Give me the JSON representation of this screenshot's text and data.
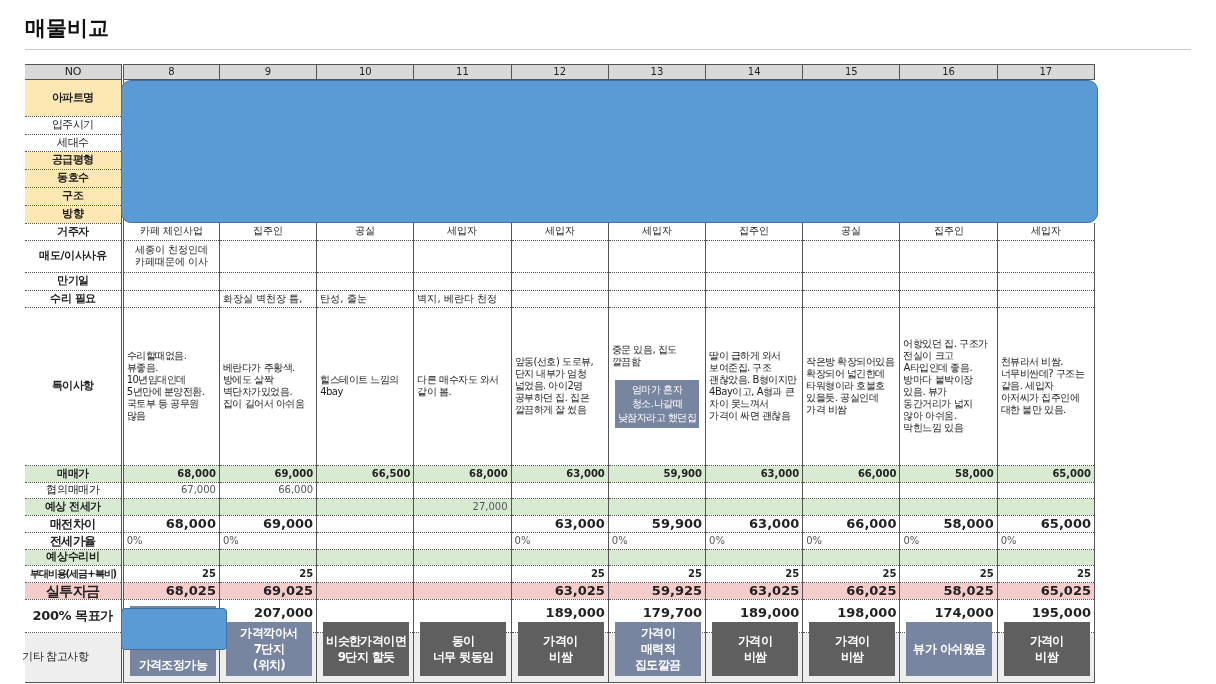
{
  "title": "매물비교",
  "rows": [
    {
      "label": "NO",
      "kind": "header",
      "color": "#d9d9d9",
      "bold": false
    },
    {
      "label": "아파트명",
      "kind": "hidden",
      "color": "#fde7b3",
      "bold": true
    },
    {
      "label": "입주시기",
      "kind": "hidden",
      "color": "#ffffff",
      "bold": false
    },
    {
      "label": "세대수",
      "kind": "hidden",
      "color": "#ffffff",
      "bold": false
    },
    {
      "label": "공급평형",
      "kind": "hidden",
      "color": "#fde7b3",
      "bold": true
    },
    {
      "label": "동호수",
      "kind": "hidden",
      "color": "#fde7b3",
      "bold": true
    },
    {
      "label": "구조",
      "kind": "hidden",
      "color": "#fde7b3",
      "bold": true
    },
    {
      "label": "방향",
      "kind": "hidden",
      "color": "#fde7b3",
      "bold": true
    },
    {
      "label": "거주자",
      "kind": "resident",
      "color": "#ffffff",
      "bold": true
    },
    {
      "label": "매도/이사사유",
      "kind": "reason",
      "color": "#ffffff",
      "bold": true
    },
    {
      "label": "만기일",
      "kind": "expiry",
      "color": "#ffffff",
      "bold": true
    },
    {
      "label": "수리 필요",
      "kind": "repair",
      "color": "#ffffff",
      "bold": true
    },
    {
      "label": "특이사항",
      "kind": "remarks",
      "color": "#ffffff",
      "bold": true
    },
    {
      "label": "매매가",
      "kind": "price",
      "color": "#d9ead3",
      "bold": true
    },
    {
      "label": "협의매매가",
      "kind": "negotiated",
      "color": "#ffffff",
      "bold": false
    },
    {
      "label": "예상 전세가",
      "kind": "jeonse",
      "color": "#d9ead3",
      "bold": true
    },
    {
      "label": "매전차이",
      "kind": "gap",
      "color": "#ffffff",
      "bold": true
    },
    {
      "label": "전세가율",
      "kind": "ratio",
      "color": "#ffffff",
      "bold": true
    },
    {
      "label": "예상수리비",
      "kind": "repair_cost",
      "color": "#d9ead3",
      "bold": true
    },
    {
      "label": "부대비용(세금+복비)",
      "kind": "extra",
      "color": "#ffffff",
      "bold": true
    },
    {
      "label": "실투자금",
      "kind": "total",
      "color": "#f4cccc",
      "bold": true
    },
    {
      "label": "200% 목표가",
      "kind": "target",
      "color": "#ffffff",
      "bold": true
    },
    {
      "label": "기타 참고사항",
      "kind": "memo",
      "color": "#eeeeee",
      "bold": false
    }
  ],
  "listings": [
    {
      "no": "8",
      "resident": "카페 체인사업",
      "reason": "세종이 친정인데\n카페때문에 이사",
      "remarks": "수리할때없음.\n뷰좋음.\n10년임대인데\n5년만에 분양전환.\n국토부 등 공무원\n많음",
      "price": "68,000",
      "negotiated": "67,000",
      "gap": "68,000",
      "ratio": "0%",
      "extra": "25",
      "total": "68,025",
      "cover": true,
      "note": {
        "text": "가격조정가능",
        "color": "#7885a0"
      }
    },
    {
      "no": "9",
      "resident": "집주인",
      "repair": "화장실 벽천장 틈,",
      "remarks": "베란다가 주황색.\n방에도 살짝\n벽단차가있었음.\n집이 길어서 아쉬움",
      "price": "69,000",
      "negotiated": "66,000",
      "gap": "69,000",
      "ratio": "0%",
      "extra": "25",
      "total": "69,025",
      "target": "207,000",
      "note": {
        "text": "가격깍아서\n7단지\n(위치)",
        "color": "#7885a0"
      }
    },
    {
      "no": "10",
      "resident": "공실",
      "repair": "탄성, 줄눈",
      "remarks": "힐스테이트 느낌의\n4bay",
      "price": "66,500",
      "note": {
        "text": "비슷한가격이면\n9단지 할듯",
        "color": "#5f5f5f"
      }
    },
    {
      "no": "11",
      "resident": "세입자",
      "repair": "벽지, 베란다 천정",
      "remarks": "다른 매수자도 와서\n같이 봄.",
      "price": "68,000",
      "jeonse": "27,000",
      "note": {
        "text": "동이\n너무 뒷동임",
        "color": "#5f5f5f"
      }
    },
    {
      "no": "12",
      "resident": "세입자",
      "remarks": "앞동(선호) 도로뷰,\n단지 내부가 엄청\n넓었음. 아이2명\n공부하던 집. 집은\n깔끔하게 잘 썼음",
      "price": "63,000",
      "gap": "63,000",
      "ratio": "0%",
      "extra": "25",
      "total": "63,025",
      "target": "189,000",
      "note": {
        "text": "가격이\n비쌈",
        "color": "#5f5f5f"
      }
    },
    {
      "no": "13",
      "resident": "세입자",
      "remarks": "중문 있음, 집도\n깔끔함",
      "remark_note": {
        "text": "엄마가 혼자\n청소.나갈때\n낮잠자라고 했던집",
        "color": "#7885a0"
      },
      "price": "59,900",
      "gap": "59,900",
      "ratio": "0%",
      "extra": "25",
      "total": "59,925",
      "target": "179,700",
      "note": {
        "text": "가격이\n매력적\n집도깔끔",
        "color": "#7885a0"
      }
    },
    {
      "no": "14",
      "resident": "집주인",
      "remarks": "딸이 급하게 와서\n보여준집. 구조\n괜찮았음. B형이지만\n4Bay이고, A형과 큰\n차이 못느껴서\n가격이 싸면 괜찮음",
      "price": "63,000",
      "gap": "63,000",
      "ratio": "0%",
      "extra": "25",
      "total": "63,025",
      "target": "189,000",
      "note": {
        "text": "가격이\n비쌈",
        "color": "#5f5f5f"
      }
    },
    {
      "no": "15",
      "resident": "공실",
      "remarks": "작은방 확장되어있음\n확장되어 넓긴한데\n타워형이라 호불호\n있을듯. 공실인데\n가격 비쌈",
      "price": "66,000",
      "gap": "66,000",
      "ratio": "0%",
      "extra": "25",
      "total": "66,025",
      "target": "198,000",
      "note": {
        "text": "가격이\n비쌈",
        "color": "#5f5f5f"
      }
    },
    {
      "no": "16",
      "resident": "집주인",
      "remarks": "어항있던 집. 구조가\n전실이 크고\nA타입인데 좋음.\n방마다 붙박이장\n있음. 뷰가\n동간거리가 넓지\n않아 아쉬움.\n막힌느낌 있음",
      "price": "58,000",
      "gap": "58,000",
      "ratio": "0%",
      "extra": "25",
      "total": "58,025",
      "target": "174,000",
      "note": {
        "text": "뷰가 아쉬웠음",
        "color": "#7885a0"
      }
    },
    {
      "no": "17",
      "resident": "세입자",
      "remarks": "천뷰라서 비쌈.\n너무비싼데? 구조는\n같음. 세입자\n아저씨가 집주인에\n대한 불만 있음.",
      "price": "65,000",
      "gap": "65,000",
      "ratio": "0%",
      "extra": "25",
      "total": "65,025",
      "target": "195,000",
      "note": {
        "text": "가격이\n비쌈",
        "color": "#5f5f5f"
      }
    }
  ]
}
